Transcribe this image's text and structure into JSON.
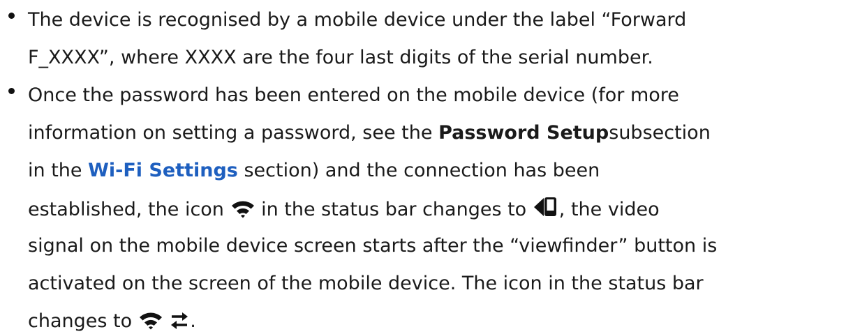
{
  "bullet1": {
    "line1": "The device is recognised by a mobile device under the label “Forward",
    "line2": "F_XXXX”, where XXXX are the four last digits of the serial number."
  },
  "bullet2": {
    "line1": "Once the password has been entered on the mobile device (for more",
    "line2_pre": "information on setting a password, see the ",
    "line2_bold": "Password Setup",
    "line2_post": "subsection",
    "line3_pre": "in the ",
    "line3_link": "Wi-Fi Settings",
    "line3_post": " section) and the connection has been",
    "line4_pre": "established, the icon ",
    "line4_mid": " in the status bar changes to ",
    "line4_post": ", the video",
    "line5": "signal on the mobile device screen starts after the “viewfinder” button is",
    "line6": "activated on the screen of the mobile device. The icon in the status bar",
    "line7_pre": "changes to ",
    "line7_post": "."
  },
  "icons": [
    "wifi-icon",
    "speaker-phone-icon",
    "transfer-arrows-icon"
  ],
  "colors": {
    "text": "#1a1a1a",
    "link": "#1e5fbf"
  }
}
